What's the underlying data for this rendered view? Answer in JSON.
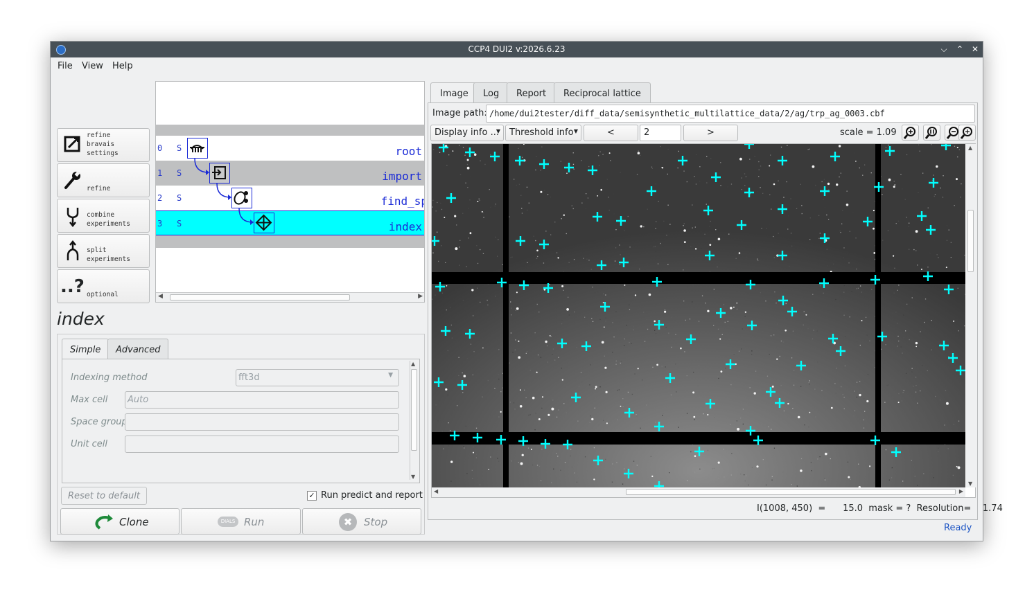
{
  "window": {
    "title": "CCP4 DUI2 v:2026.6.23"
  },
  "menu": [
    "File",
    "View",
    "Help"
  ],
  "tool_buttons": [
    {
      "label": "refine\nbravais\nsettings",
      "icon": "bravais-icon"
    },
    {
      "label": "refine",
      "icon": "wrench-icon"
    },
    {
      "label": "combine\nexperiments",
      "icon": "merge-icon"
    },
    {
      "label": "split\nexperiments",
      "icon": "split-icon"
    },
    {
      "label": "optional",
      "icon": "question-icon"
    }
  ],
  "graph": {
    "rows": [
      {
        "num": "0",
        "state": "S",
        "name": "root"
      },
      {
        "num": "1",
        "state": "S",
        "name": "import"
      },
      {
        "num": "2",
        "state": "S",
        "name": "find_sp"
      },
      {
        "num": "3",
        "state": "S",
        "name": "index"
      }
    ]
  },
  "step_title": "index",
  "params": {
    "tabs": [
      "Simple",
      "Advanced"
    ],
    "indexing_method_label": "Indexing method",
    "indexing_method_value": "fft3d",
    "max_cell_label": "Max cell",
    "max_cell_placeholder": "Auto",
    "space_group_label": "Space group",
    "unit_cell_label": "Unit cell",
    "reset_label": "Reset to default",
    "run_predict_label": "Run predict and report"
  },
  "actions": {
    "clone": "Clone",
    "run": "Run",
    "stop": "Stop",
    "dials_badge": "DIALS"
  },
  "viewer": {
    "tabs": [
      "Image",
      "Log",
      "Report",
      "Reciprocal lattice"
    ],
    "image_path_label": "Image path:",
    "image_path": "/home/dui2tester/diff_data/semisynthetic_multilattice_data/2/ag/trp_ag_0003.cbf",
    "display_info": "Display info ...",
    "threshold_info": "Threshold info",
    "prev": "<",
    "next": ">",
    "image_number": "2",
    "scale": "scale = 1.09",
    "pixel_info": "I(1008, 450)  =      15.0  mask = ?  Resolution=    1.74"
  },
  "status": "Ready",
  "colors": {
    "spot_marker": "#00ffff",
    "node_blue": "#1a2ad6",
    "selected_row": "#00ffff"
  }
}
